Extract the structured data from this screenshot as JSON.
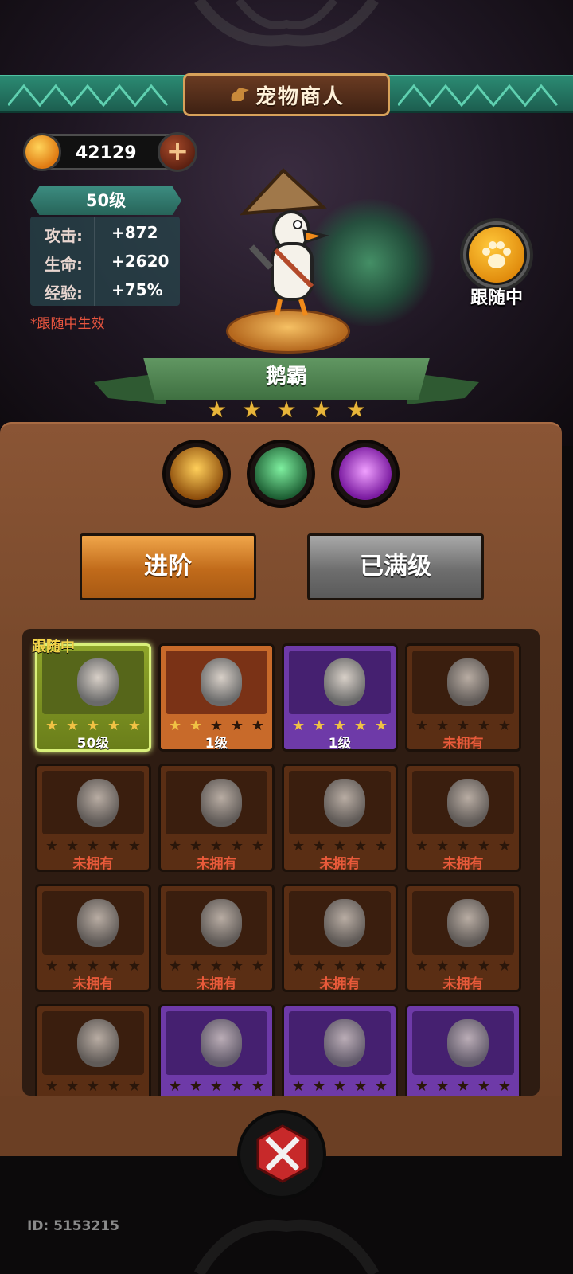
{
  "header": {
    "title": "宠物商人",
    "title_icon": "goose-head-icon"
  },
  "currency": {
    "amount": "42129",
    "icon": "coin-icon",
    "add_icon": "plus-icon"
  },
  "pet_stats": {
    "level": "50级",
    "rows": [
      {
        "label": "攻击:",
        "value": "+872"
      },
      {
        "label": "生命:",
        "value": "+2620"
      },
      {
        "label": "经验:",
        "value": "+75%"
      }
    ],
    "note": "*跟随中生效"
  },
  "follow_button": {
    "label": "跟随中",
    "icon": "paw-icon"
  },
  "selected_pet": {
    "name": "鹅霸",
    "stars": 5
  },
  "skills": [
    {
      "name": "shadow-strike-skill-icon",
      "color": "#e8a828"
    },
    {
      "name": "green-slash-skill-icon",
      "color": "#3fbf6a"
    },
    {
      "name": "purple-chat-skill-icon",
      "color": "#c04ad8"
    }
  ],
  "actions": {
    "advance": "进阶",
    "max_level": "已满级"
  },
  "grid": {
    "follow_tag": "跟随中",
    "pets": [
      {
        "icon": "goose-pet-icon",
        "rarity": "active",
        "stars": 5,
        "label": "50级",
        "owned": true
      },
      {
        "icon": "cat-pet-icon",
        "rarity": "orange",
        "stars": 2,
        "label": "1级",
        "owned": true
      },
      {
        "icon": "owl-pet-icon",
        "rarity": "purple",
        "stars": 5,
        "label": "1级",
        "owned": true
      },
      {
        "icon": "mimic-pet-icon",
        "rarity": "normal",
        "stars": 0,
        "label": "未拥有",
        "owned": false
      },
      {
        "icon": "dragon-pet-icon",
        "rarity": "normal",
        "stars": 0,
        "label": "未拥有",
        "owned": false
      },
      {
        "icon": "knight-pet-icon",
        "rarity": "normal",
        "stars": 0,
        "label": "未拥有",
        "owned": false
      },
      {
        "icon": "daruma-pet-icon",
        "rarity": "normal",
        "stars": 0,
        "label": "未拥有",
        "owned": false
      },
      {
        "icon": "gauntlet-pet-icon",
        "rarity": "normal",
        "stars": 0,
        "label": "未拥有",
        "owned": false
      },
      {
        "icon": "clown-pet-icon",
        "rarity": "normal",
        "stars": 0,
        "label": "未拥有",
        "owned": false
      },
      {
        "icon": "crow-pet-icon",
        "rarity": "normal",
        "stars": 0,
        "label": "未拥有",
        "owned": false
      },
      {
        "icon": "crystal-beast-pet-icon",
        "rarity": "normal",
        "stars": 0,
        "label": "未拥有",
        "owned": false
      },
      {
        "icon": "bear-pet-icon",
        "rarity": "normal",
        "stars": 0,
        "label": "未拥有",
        "owned": false
      },
      {
        "icon": "robot-pet-icon",
        "rarity": "normal",
        "stars": 0,
        "label": "",
        "owned": false
      },
      {
        "icon": "frog-pet-icon",
        "rarity": "purple",
        "stars": 0,
        "label": "",
        "owned": false
      },
      {
        "icon": "chicken-pet-icon",
        "rarity": "purple",
        "stars": 0,
        "label": "",
        "owned": false
      },
      {
        "icon": "zombie-bird-pet-icon",
        "rarity": "purple",
        "stars": 0,
        "label": "",
        "owned": false
      }
    ]
  },
  "close_button": {
    "icon": "close-x-icon"
  },
  "footer": {
    "user_id": "ID: 5153215"
  },
  "colors": {
    "accent_green": "#2b8a72",
    "wood": "#7a4a2c",
    "star": "#f0c244",
    "unowned": "#e85a3a"
  }
}
